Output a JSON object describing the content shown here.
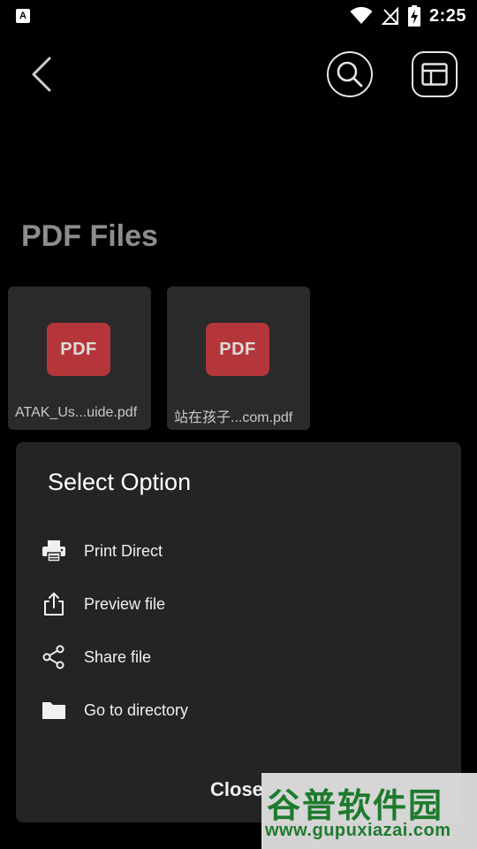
{
  "status_bar": {
    "app_icon": "A",
    "time": "2:25",
    "icons": [
      "wifi-icon",
      "no-signal-icon",
      "battery-charging-icon"
    ]
  },
  "toolbar": {
    "back_icon": "chevron-left-icon",
    "search_icon": "search-icon",
    "layout_icon": "layout-icon"
  },
  "page": {
    "title": "PDF Files"
  },
  "files": [
    {
      "badge": "PDF",
      "name": "ATAK_Us...uide.pdf"
    },
    {
      "badge": "PDF",
      "name": "站在孩子...com.pdf"
    }
  ],
  "sheet": {
    "title": "Select Option",
    "options": [
      {
        "icon": "printer-icon",
        "label": "Print Direct"
      },
      {
        "icon": "upload-icon",
        "label": "Preview file"
      },
      {
        "icon": "share-icon",
        "label": "Share file"
      },
      {
        "icon": "folder-icon",
        "label": "Go to directory"
      }
    ],
    "close_label": "Close"
  },
  "watermark": {
    "line1": "谷普软件园",
    "line2": "www.gupuxiazai.com"
  }
}
